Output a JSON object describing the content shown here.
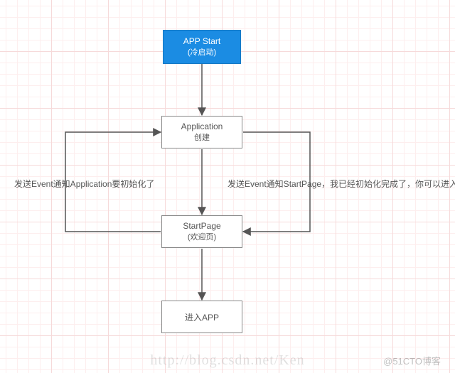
{
  "nodes": {
    "start": {
      "title": "APP Start",
      "sub": "(冷启动)"
    },
    "application": {
      "title": "Application",
      "sub": "创建"
    },
    "startpage": {
      "title": "StartPage",
      "sub": "(欢迎页)"
    },
    "enter": {
      "title": "进入APP"
    }
  },
  "labels": {
    "left": "发送Event通知Application要初始化了",
    "right": "发送Event通知StartPage，我已经初始化完成了，你可以进入app了"
  },
  "watermark": {
    "url": "http://blog.csdn.net/Ken",
    "brand": "@51CTO博客"
  },
  "chart_data": {
    "type": "flowchart",
    "title": "",
    "nodes": [
      {
        "id": "start",
        "label": "APP Start (冷启动)",
        "kind": "start"
      },
      {
        "id": "application",
        "label": "Application 创建",
        "kind": "process"
      },
      {
        "id": "startpage",
        "label": "StartPage (欢迎页)",
        "kind": "process"
      },
      {
        "id": "enter",
        "label": "进入APP",
        "kind": "process"
      }
    ],
    "edges": [
      {
        "from": "start",
        "to": "application",
        "label": ""
      },
      {
        "from": "application",
        "to": "startpage",
        "label": ""
      },
      {
        "from": "startpage",
        "to": "application",
        "label": "发送Event通知Application要初始化了",
        "path": "left-loop"
      },
      {
        "from": "application",
        "to": "startpage",
        "label": "发送Event通知StartPage，我已经初始化完成了，你可以进入app了",
        "path": "right-loop"
      },
      {
        "from": "startpage",
        "to": "enter",
        "label": ""
      }
    ]
  }
}
